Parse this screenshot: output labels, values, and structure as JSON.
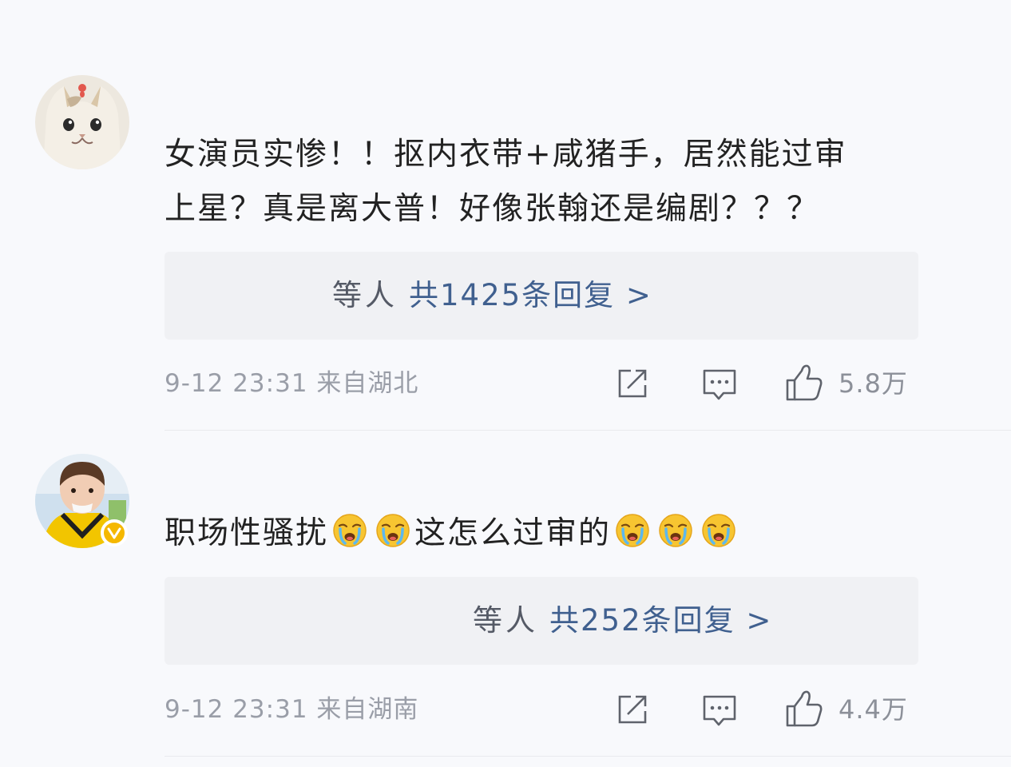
{
  "comments": [
    {
      "text_line1": "女演员实惨！！抠内衣带+咸猪手，居然能过审",
      "text_line2": "上星？真是离大普！好像张翰还是编剧？？？",
      "reply_users": "等人",
      "reply_count": "共1425条回复 >",
      "meta": "9-12 23:31 来自湖北",
      "likes": "5.8万"
    },
    {
      "text_part1": "职场性骚扰",
      "text_part2": "这怎么过审的",
      "reply_users": "等人",
      "reply_count": "共252条回复 >",
      "meta": "9-12 23:31 来自湖南",
      "likes": "4.4万"
    }
  ],
  "icons": {
    "share": "share-icon",
    "comment": "comment-icon",
    "like": "thumbs-up-icon",
    "emoji": "crying-face-emoji",
    "verified": "verified-badge-icon"
  },
  "colors": {
    "text": "#222222",
    "link": "#40608f",
    "meta": "#9a9ea8",
    "badge": "#f5b800"
  }
}
